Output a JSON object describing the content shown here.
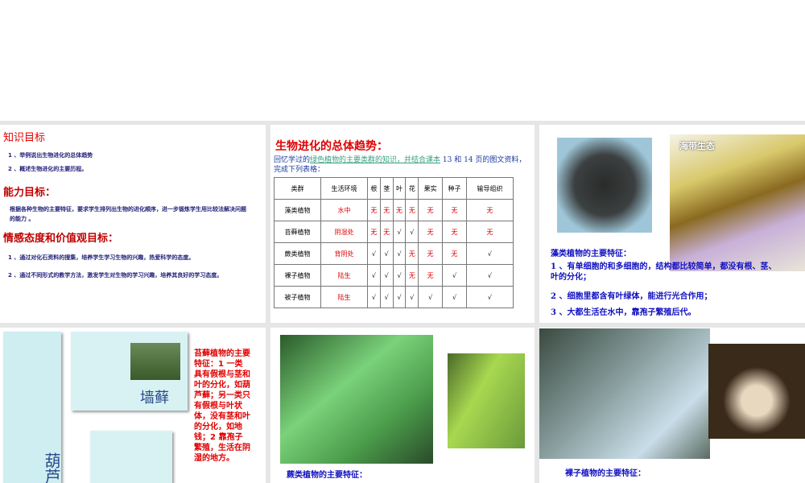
{
  "slides": [
    {
      "title": "知识目标",
      "items": [
        "1 、举例说出生物进化的总体趋势",
        "2 、概述生物进化的主要历程。"
      ],
      "ability_title": "能力目标：",
      "ability_text": "根据各种生物的主要特征，要求学生排列出生物的进化顺序，进一步锻炼学生用比较法解决问题的能力 。",
      "values_title": "情感态度和价值观目标：",
      "values_items": [
        "1 、通过对化石资料的搜集，培养学生学习生物的兴趣，热爱科学的态度。",
        "2 、通过不同形式的教学方法，激发学生对生物的学习兴趣，培养其良好的学习态度。"
      ]
    },
    {
      "title": "生物进化的总体趋势：",
      "intro_a": "回忆学过的",
      "intro_link": "绿色植物的主要类群的知识，并结合课本",
      "intro_b": " 13 和 14 页的图文资料，完成下列表格：",
      "headers": [
        "类群",
        "生活环境",
        "根",
        "茎",
        "叶",
        "花",
        "果实",
        "种子",
        "输导组织"
      ],
      "rows": [
        [
          "藻类植物",
          "水中",
          "无",
          "无",
          "无",
          "无",
          "无",
          "无",
          "无"
        ],
        [
          "苔藓植物",
          "阴湿处",
          "无",
          "无",
          "√",
          "√",
          "无",
          "无",
          "无"
        ],
        [
          "蕨类植物",
          "背阴处",
          "√",
          "√",
          "√",
          "无",
          "无",
          "无",
          "√"
        ],
        [
          "裸子植物",
          "陆生",
          "√",
          "√",
          "√",
          "无",
          "无",
          "√",
          "√"
        ],
        [
          "被子植物",
          "陆生",
          "√",
          "√",
          "√",
          "√",
          "√",
          "√",
          "√"
        ]
      ]
    },
    {
      "image_label": "海带生态",
      "title": "藻类植物的主要特征：",
      "items": [
        "1 、有单细胞的和多细胞的，结构都比较简单，都没有根、茎、叶的分化；",
        "2 、细胞里都含有叶绿体，能进行光合作用；",
        "3 、大都生活在水中，靠孢子繁殖后代。"
      ]
    },
    {
      "label_a": "墙藓",
      "label_b": "葫芦",
      "text": "苔藓植物的主要特征：1 一类具有假根与茎和叶的分化，如葫芦藓；另一类只有假根与叶状体，没有茎和叶的分化，如地钱；2 靠孢子繁殖，生活在阴湿的地方。"
    },
    {
      "title": "蕨类植物的主要特征："
    },
    {
      "title": "裸子植物的主要特征："
    }
  ]
}
